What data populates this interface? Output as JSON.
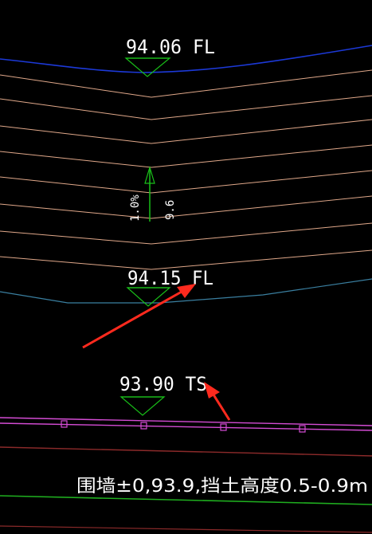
{
  "drawing": {
    "background": "#000000",
    "colors": {
      "blue_boundary": "#1c39d8",
      "contour": "#e0a88a",
      "cyan_line": "#3a7fa0",
      "marker": "#19c019",
      "arrow_red": "#ff2a1e",
      "magenta_wall": "#d44cd4",
      "maroon_line": "#8b2a2a",
      "green_line": "#1fae1f",
      "text": "#ffffff"
    },
    "elevations": {
      "top_fl": "94.06 FL",
      "mid_fl": "94.15 FL",
      "ts": "93.90 TS"
    },
    "slope": {
      "percent": "1.0%",
      "length": "9.6"
    },
    "wall_note": "围墙±0,93.9,挡土高度0.5-0.9m"
  }
}
